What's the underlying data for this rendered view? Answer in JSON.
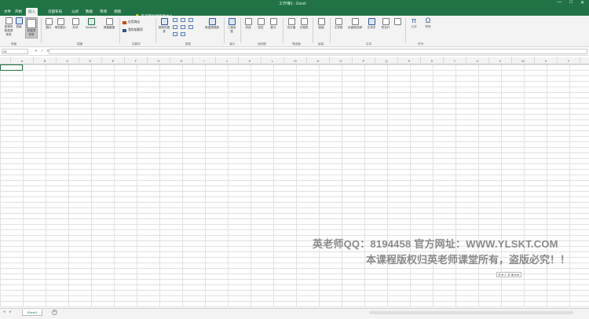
{
  "titlebar": {
    "title": "工作簿1 - Excel",
    "min": "—",
    "max": "□",
    "close": "✕"
  },
  "tabs": [
    "文件",
    "开始",
    "插入",
    "页面布局",
    "公式",
    "数据",
    "审阅",
    "视图",
    "帮助"
  ],
  "active_tab_index": 2,
  "tell_me": "告诉我你想要做什么",
  "ribbon": {
    "buttons": [
      {
        "label": "数据透视表"
      },
      {
        "label": "推荐的数据透视表"
      },
      {
        "label": "表格"
      },
      {
        "label": "图片"
      },
      {
        "label": "联机图片"
      },
      {
        "label": "形状"
      },
      {
        "label": "SmartArt"
      },
      {
        "label": "屏幕截图"
      },
      {
        "label": "推荐的图表"
      },
      {
        "label": "数据透视图"
      },
      {
        "label": "三维地图"
      },
      {
        "label": "折线"
      },
      {
        "label": "柱形"
      },
      {
        "label": "盈亏"
      },
      {
        "label": "切片器"
      },
      {
        "label": "日程表"
      },
      {
        "label": "链接"
      },
      {
        "label": "文本框"
      },
      {
        "label": "页眉和页脚"
      },
      {
        "label": "艺术字"
      },
      {
        "label": "签名行"
      },
      {
        "label": "公式"
      },
      {
        "label": "符号"
      }
    ],
    "addins": [
      "应用商店",
      "我的加载项"
    ],
    "groups": [
      "表格",
      "插图",
      "加载项",
      "图表",
      "演示",
      "迷你图",
      "筛选器",
      "链接",
      "文本",
      "符号"
    ]
  },
  "formula_bar": {
    "name_box": "A1",
    "fx": "fx",
    "cancel": "✕",
    "enter": "✓",
    "value": ""
  },
  "columns": [
    "A",
    "B",
    "C",
    "D",
    "E",
    "F",
    "G",
    "H",
    "I",
    "J",
    "K",
    "L",
    "M",
    "N",
    "O",
    "P",
    "Q",
    "R",
    "S",
    "T",
    "U",
    "V",
    "W",
    "X",
    "Y",
    "Z"
  ],
  "sheet": {
    "tab": "Sheet1",
    "add": "+"
  },
  "watermark": {
    "line1": "英老师QQ：8194458 官方网址：WWW.YLSKT.COM",
    "line2": "本课程版权归英老师课堂所有，盗版必究！！"
  },
  "mini_toolbar": "E ▾ ✓ ✕ ⊞ A ▾"
}
